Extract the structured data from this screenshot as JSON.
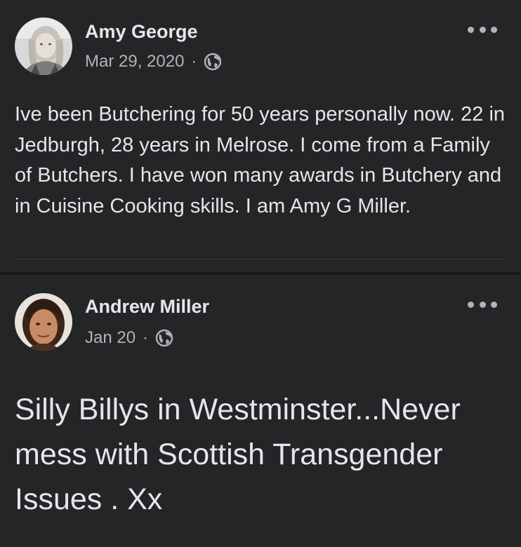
{
  "posts": [
    {
      "author": "Amy George",
      "date": "Mar 29, 2020",
      "separator": "·",
      "privacy_icon": "globe-icon",
      "text": "Ive been Butchering for 50 years personally now. 22 in Jedburgh, 28 years in Melrose. I come from a Family of Butchers. I have won many awards in Butchery and in Cuisine Cooking skills. I am Amy G Miller."
    },
    {
      "author": "Andrew Miller",
      "date": "Jan 20",
      "separator": "·",
      "privacy_icon": "globe-icon",
      "text": "Silly Billys in Westminster...Never mess with Scottish Transgender Issues . Xx"
    }
  ],
  "more_icon": "more-options-icon",
  "colors": {
    "background": "#242526",
    "text_primary": "#e4e6eb",
    "text_secondary": "#b0b3b8"
  }
}
